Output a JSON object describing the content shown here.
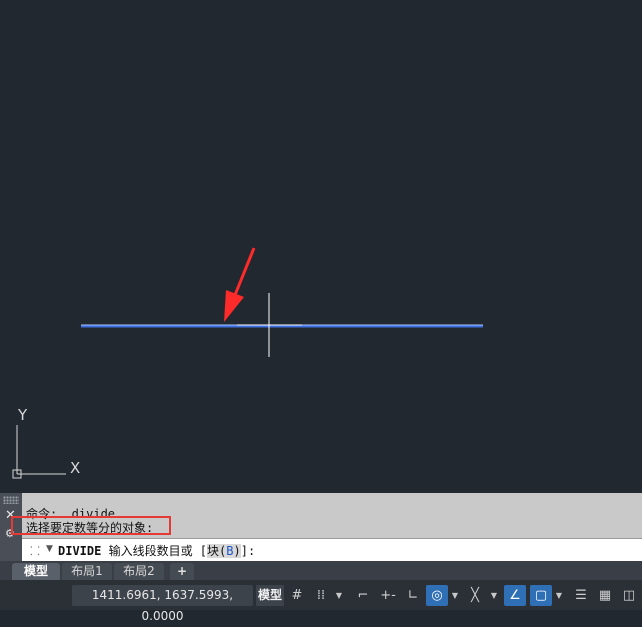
{
  "canvas": {
    "axis_x_label": "X",
    "axis_y_label": "Y"
  },
  "command": {
    "history_line1": "命令:  divide",
    "history_line2": "选择要定数等分的对象:",
    "prompt_command": "DIVIDE",
    "prompt_text": " 输入线段数目或 [",
    "prompt_option": "块(",
    "prompt_option_key": "B",
    "prompt_option_close": ")",
    "prompt_end": "]:"
  },
  "tabs": {
    "model": "模型",
    "layout1": "布局1",
    "layout2": "布局2",
    "add": "+"
  },
  "status": {
    "coordinates": "1411.6961, 1637.5993, 0.0000",
    "model_label": "模型"
  },
  "colors": {
    "canvas_bg": "#212830",
    "line": "#3d6fe0",
    "arrow": "#ff2a2a",
    "highlight_box": "#e53935",
    "active_toggle": "#2f6fb6"
  }
}
